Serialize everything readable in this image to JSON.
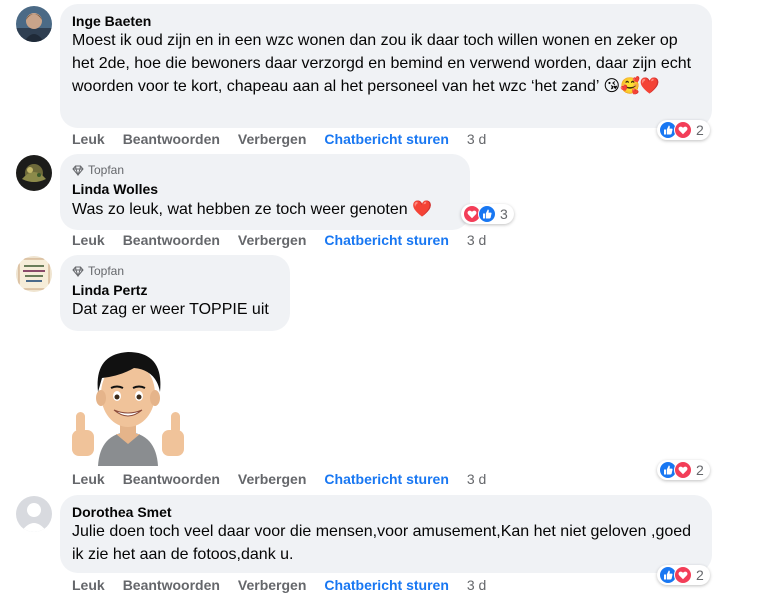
{
  "comments": [
    {
      "author": "Inge Baeten",
      "text": "Moest ik oud zijn en in een wzc wonen dan zou ik daar toch willen wonen en zeker op het 2de, hoe die bewoners daar verzorgd en bemind en verwend worden, daar zijn echt woorden voor te kort, chapeau aan al het personeel van het wzc ‘het zand’",
      "emojis": "😘🥰❤️",
      "reaction_count": "2"
    },
    {
      "badge": "Topfan",
      "author": "Linda Wolles",
      "text": "Was zo leuk, wat hebben ze toch weer genoten",
      "emojis": "❤️",
      "reaction_count": "3"
    },
    {
      "badge": "Topfan",
      "author": "Linda Pertz",
      "text": "Dat zag er weer TOPPIE uit",
      "reaction_count": "2"
    },
    {
      "author": "Dorothea Smet",
      "text": "Julie doen toch veel daar voor die mensen,voor amusement,Kan het niet geloven ,goed ik zie het aan de fotoos,dank u.",
      "reaction_count": "2"
    }
  ],
  "actions": {
    "like": "Leuk",
    "reply": "Beantwoorden",
    "hide": "Verbergen",
    "chat": "Chatbericht sturen",
    "time": "3 d"
  },
  "colors": {
    "bubble": "#f0f2f5",
    "secondary_text": "#65676b",
    "accent": "#1877f2",
    "love": "#f33e58"
  }
}
